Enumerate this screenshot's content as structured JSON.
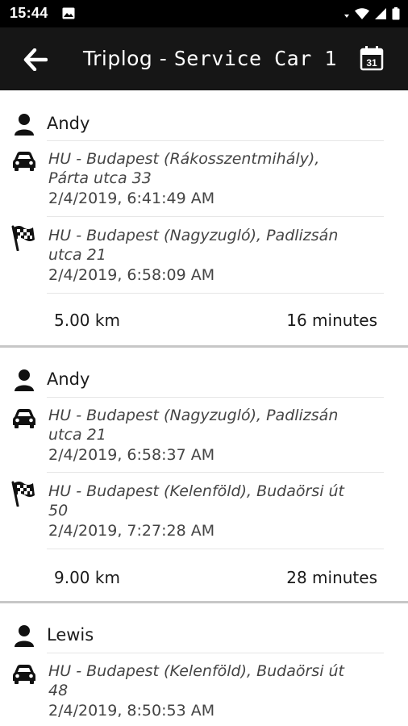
{
  "status_bar": {
    "time": "15:44"
  },
  "header": {
    "title_prefix": "Triplog - ",
    "title_car": "Service Car 1"
  },
  "trips": [
    {
      "driver": "Andy",
      "start_address_line1": "HU - Budapest (Rákosszentmihály),",
      "start_address_line2": "Párta utca 33",
      "start_time": "2/4/2019, 6:41:49 AM",
      "end_address_line1": "HU - Budapest (Nagyzugló), Padlizsán",
      "end_address_line2": "utca 21",
      "end_time": "2/4/2019, 6:58:09 AM",
      "distance": "5.00 km",
      "duration": "16 minutes"
    },
    {
      "driver": "Andy",
      "start_address_line1": "HU - Budapest (Nagyzugló), Padlizsán",
      "start_address_line2": "utca 21",
      "start_time": "2/4/2019, 6:58:37 AM",
      "end_address_line1": "HU - Budapest (Kelenföld), Budaörsi út",
      "end_address_line2": "50",
      "end_time": "2/4/2019, 7:27:28 AM",
      "distance": "9.00 km",
      "duration": "28 minutes"
    },
    {
      "driver": "Lewis",
      "start_address_line1": "HU - Budapest (Kelenföld), Budaörsi út",
      "start_address_line2": "48",
      "start_time": "2/4/2019, 8:50:53 AM"
    }
  ],
  "icons": {
    "back": "arrow-left-icon",
    "calendar": "calendar-icon",
    "driver": "person-icon",
    "start": "car-icon",
    "end": "checkered-flag-icon"
  },
  "colors": {
    "app_bar": "#161616",
    "status_bar": "#000000",
    "divider": "#c7c7c7"
  }
}
